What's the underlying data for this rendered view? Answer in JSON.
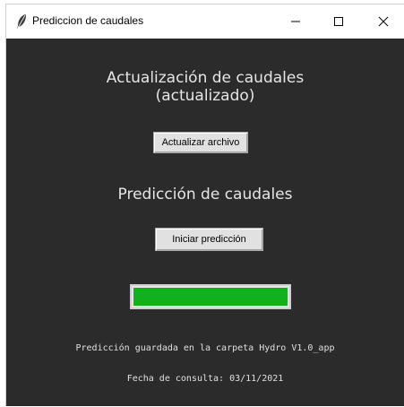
{
  "window": {
    "title": "Prediccion de caudales",
    "background": "#2b2b2b",
    "icons": {
      "app": "feather-icon",
      "minimize": "minimize-icon",
      "maximize": "maximize-icon",
      "close": "close-icon"
    }
  },
  "update_section": {
    "heading_line1": "Actualización de caudales",
    "heading_line2": "(actualizado)",
    "button_label": "Actualizar archivo"
  },
  "prediction_section": {
    "heading": "Predicción de caudales",
    "button_label": "Iniciar predicción",
    "progress_fraction": 1.0,
    "progress_color": "#12b01e"
  },
  "status": {
    "saved_message": "Predicción guardada en la carpeta Hydro V1.0_app",
    "query_date": "Fecha de consulta: 03/11/2021"
  }
}
